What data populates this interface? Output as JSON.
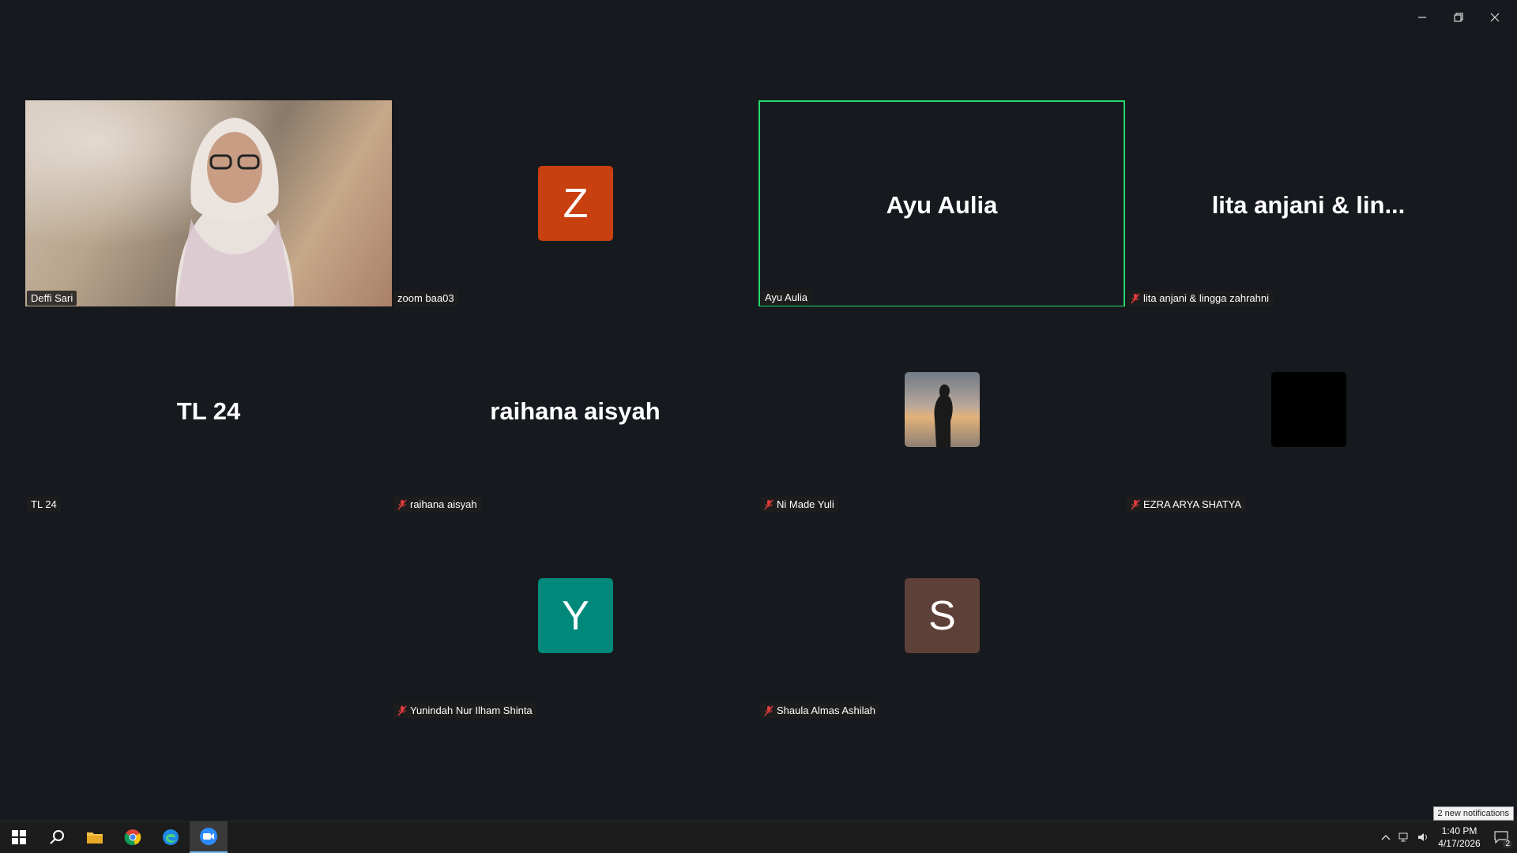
{
  "window": {
    "controls": [
      "minimize-icon",
      "restore-icon",
      "close-icon"
    ]
  },
  "participants": [
    {
      "id": "deffi",
      "label": "Deffi Sari",
      "type": "video",
      "muted": false
    },
    {
      "id": "zoom",
      "label": "zoom baa03",
      "type": "avatar",
      "initial": "Z",
      "color": "#c8400f",
      "muted": false
    },
    {
      "id": "ayu",
      "label": "Ayu Aulia",
      "type": "name",
      "display": "Ayu Aulia",
      "muted": false,
      "active_speaker": true
    },
    {
      "id": "lita",
      "label": "lita anjani & lingga zahrahni",
      "type": "name",
      "display": "lita anjani & lin...",
      "muted": true
    },
    {
      "id": "tl24",
      "label": "TL 24",
      "type": "name",
      "display": "TL 24",
      "muted": false
    },
    {
      "id": "raihana",
      "label": "raihana aisyah",
      "type": "name",
      "display": "raihana aisyah",
      "muted": true
    },
    {
      "id": "nimade",
      "label": "Ni Made Yuli",
      "type": "photo",
      "muted": true
    },
    {
      "id": "ezra",
      "label": "EZRA ARYA SHATYA",
      "type": "black",
      "muted": true
    },
    {
      "id": "yunindah",
      "label": "Yunindah Nur Ilham Shinta",
      "type": "avatar",
      "initial": "Y",
      "color": "#00897b",
      "muted": true
    },
    {
      "id": "shaula",
      "label": "Shaula Almas Ashilah",
      "type": "avatar",
      "initial": "S",
      "color": "#5d4037",
      "muted": true
    }
  ],
  "taskbar": {
    "apps": [
      "windows-start-icon",
      "search-icon",
      "file-explorer-icon",
      "chrome-icon",
      "edge-icon",
      "zoom-icon"
    ],
    "clock_time": "1:40 PM",
    "clock_date": "4/17/2026",
    "notification_tip": "2 new notifications",
    "notification_count": "2"
  }
}
